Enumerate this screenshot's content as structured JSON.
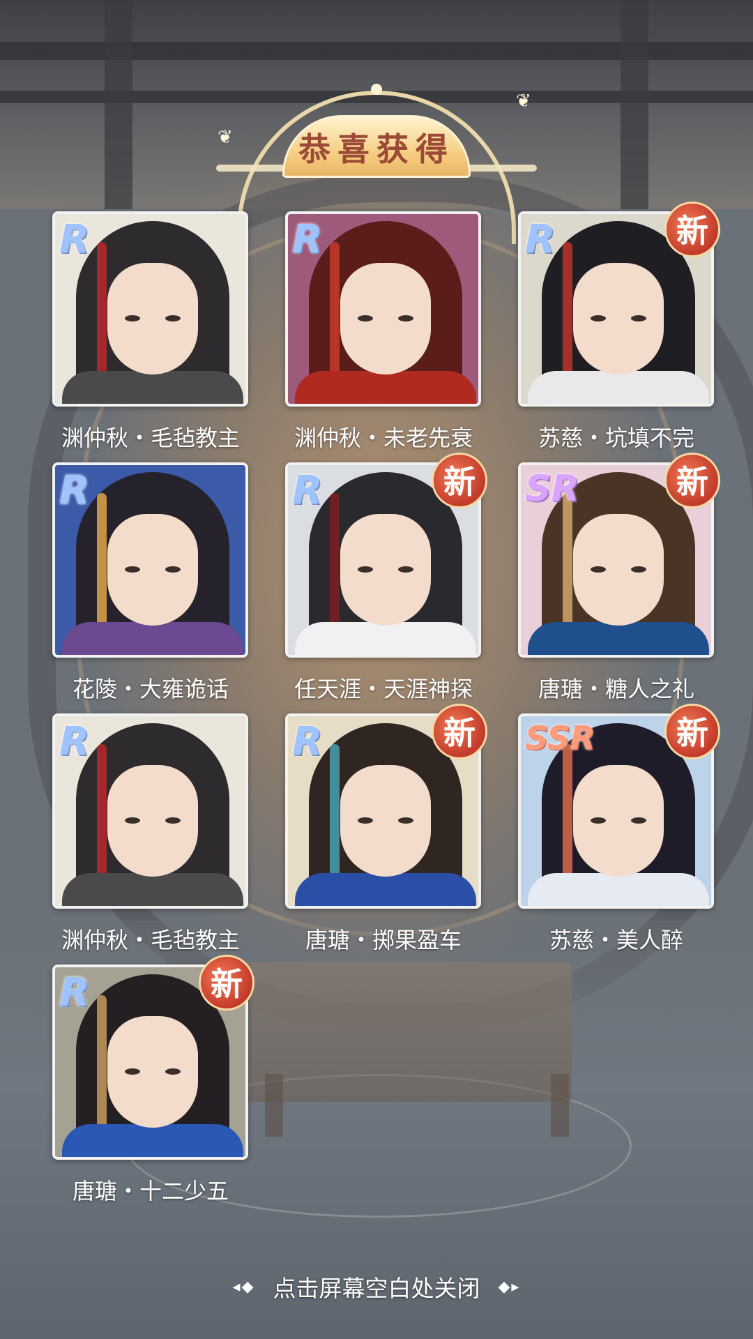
{
  "header": {
    "title": "恭喜获得"
  },
  "cards": [
    {
      "rarity": "R",
      "name": "渊仲秋・毛毡教主",
      "is_new": false,
      "palette": {
        "bg": "#eae6dc",
        "hair": "#2d2b2e",
        "robe": "#4a4a4a",
        "accent": "#b8272a"
      }
    },
    {
      "rarity": "R",
      "name": "渊仲秋・未老先衰",
      "is_new": false,
      "palette": {
        "bg": "#9d5a7a",
        "hair": "#5a1d1a",
        "robe": "#b02a22",
        "accent": "#c83a2a"
      }
    },
    {
      "rarity": "R",
      "name": "苏慈・坑填不完",
      "is_new": true,
      "badge": "新",
      "palette": {
        "bg": "#dcd8cc",
        "hair": "#1f1e22",
        "robe": "#e9e9ec",
        "accent": "#c0332c"
      }
    },
    {
      "rarity": "R",
      "name": "花陵・大雍诡话",
      "is_new": false,
      "palette": {
        "bg": "#3b5aa8",
        "hair": "#26222c",
        "robe": "#6b4a92",
        "accent": "#e1a54a"
      }
    },
    {
      "rarity": "R",
      "name": "任天涯・天涯神探",
      "is_new": true,
      "badge": "新",
      "palette": {
        "bg": "#dadde2",
        "hair": "#2a2a2e",
        "robe": "#f1f1f3",
        "accent": "#7b1f22"
      }
    },
    {
      "rarity": "SR",
      "name": "唐瑭・糖人之礼",
      "is_new": true,
      "badge": "新",
      "palette": {
        "bg": "#e9cfd8",
        "hair": "#4a3426",
        "robe": "#1f4f8c",
        "accent": "#d2a46a"
      }
    },
    {
      "rarity": "R",
      "name": "渊仲秋・毛毡教主",
      "is_new": false,
      "palette": {
        "bg": "#eae6dc",
        "hair": "#2d2b2e",
        "robe": "#4a4a4a",
        "accent": "#b8272a"
      }
    },
    {
      "rarity": "R",
      "name": "唐瑭・掷果盈车",
      "is_new": true,
      "badge": "新",
      "palette": {
        "bg": "#e7dcc6",
        "hair": "#2f2622",
        "robe": "#2b4fa6",
        "accent": "#4aa0b0"
      }
    },
    {
      "rarity": "SSR",
      "name": "苏慈・美人醉",
      "is_new": true,
      "badge": "新",
      "palette": {
        "bg": "#bcd3ea",
        "hair": "#1f1c2a",
        "robe": "#e6eaf2",
        "accent": "#d96a4a"
      }
    },
    {
      "rarity": "R",
      "name": "唐瑭・十二少五",
      "is_new": true,
      "badge": "新",
      "palette": {
        "bg": "#a6a293",
        "hair": "#231f22",
        "robe": "#2a58b4",
        "accent": "#c79b5d"
      }
    }
  ],
  "footer": {
    "hint": "点击屏幕空白处关闭",
    "left_ornament": "◂◆",
    "right_ornament": "◆▸"
  }
}
